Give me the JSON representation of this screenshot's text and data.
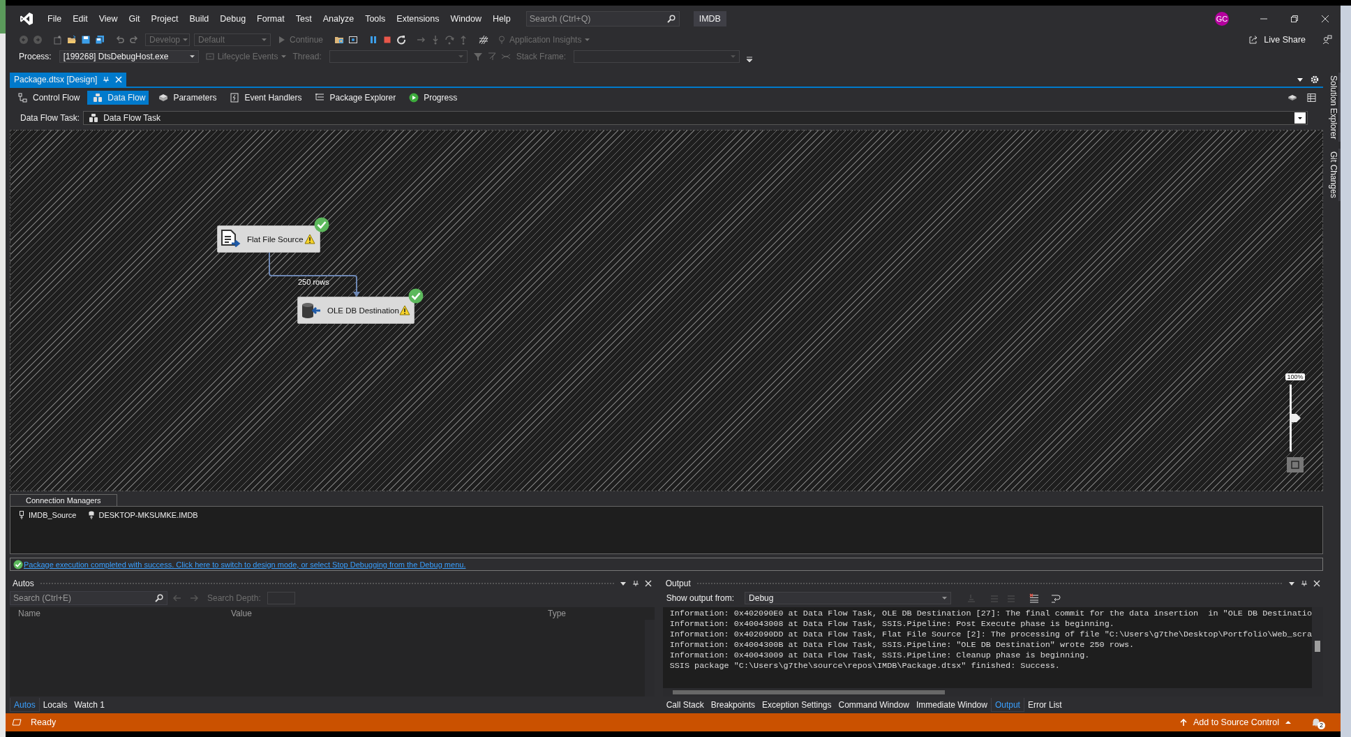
{
  "menu": [
    "File",
    "Edit",
    "View",
    "Git",
    "Project",
    "Build",
    "Debug",
    "Format",
    "Test",
    "Analyze",
    "Tools",
    "Extensions",
    "Window",
    "Help"
  ],
  "search": {
    "placeholder": "Search (Ctrl+Q)"
  },
  "solution_name": "IMDB",
  "user_initials": "GC",
  "toolbar": {
    "configuration": {
      "label": "Develop",
      "disabled": true
    },
    "platform": {
      "label": "Default",
      "disabled": true
    },
    "continue": {
      "label": "Continue",
      "disabled": true
    },
    "application_insights": {
      "label": "Application Insights",
      "disabled": true
    },
    "live_share": "Live Share"
  },
  "debug_bar": {
    "process_label": "Process:",
    "process": "[199268] DtsDebugHost.exe",
    "lifecycle": {
      "label": "Lifecycle Events",
      "disabled": true
    },
    "thread_label": {
      "label": "Thread:",
      "disabled": true
    },
    "stack_frame_label": {
      "label": "Stack Frame:",
      "disabled": true
    }
  },
  "document_tab": {
    "title": "Package.dtsx [Design]",
    "selected": true
  },
  "designer_tabs": [
    {
      "label": "Control Flow",
      "kind": "control",
      "selected": false
    },
    {
      "label": "Data Flow",
      "kind": "dataflow",
      "selected": true
    },
    {
      "label": "Parameters",
      "kind": "parameters",
      "selected": false
    },
    {
      "label": "Event Handlers",
      "kind": "events",
      "selected": false
    },
    {
      "label": "Package Explorer",
      "kind": "explorer",
      "selected": false
    },
    {
      "label": "Progress",
      "kind": "progress",
      "selected": false
    }
  ],
  "task_selector": {
    "label": "Data Flow Task:",
    "value": "Data Flow Task"
  },
  "canvas": {
    "nodes": [
      {
        "label": "Flat File Source",
        "kind": "source",
        "succeeded": true,
        "warning": true
      },
      {
        "label": "OLE DB Destination",
        "kind": "destination",
        "succeeded": true,
        "warning": true
      }
    ],
    "path_label": "250 rows",
    "zoom": {
      "label": "100%",
      "level": 0.5
    }
  },
  "connection_managers": {
    "title": "Connection Managers",
    "items": [
      {
        "label": "IMDB_Source",
        "kind": "flat_file"
      },
      {
        "label": "DESKTOP-MKSUMKE.IMDB",
        "kind": "oledb"
      }
    ]
  },
  "status_message": "Package execution completed with success. Click here to switch to design mode, or select Stop Debugging from the Debug menu.",
  "autos": {
    "title": "Autos",
    "search_placeholder": "Search (Ctrl+E)",
    "search_depth_label": "Search Depth:",
    "columns": [
      "Name",
      "Value",
      "Type"
    ],
    "tabs": [
      {
        "label": "Autos",
        "selected": true
      },
      {
        "label": "Locals",
        "selected": false
      },
      {
        "label": "Watch 1",
        "selected": false
      }
    ]
  },
  "output": {
    "title": "Output",
    "show_from_label": "Show output from:",
    "source": "Debug",
    "lines": [
      "Information: 0x402090E0 at Data Flow Task, OLE DB Destination [27]: The final commit for the data insertion  in \"OLE DB Destinatio",
      "Information: 0x40043008 at Data Flow Task, SSIS.Pipeline: Post Execute phase is beginning.",
      "Information: 0x402090DD at Data Flow Task, Flat File Source [2]: The processing of file \"C:\\Users\\g7the\\Desktop\\Portfolio\\Web_scra",
      "Information: 0x4004300B at Data Flow Task, SSIS.Pipeline: \"OLE DB Destination\" wrote 250 rows.",
      "Information: 0x40043009 at Data Flow Task, SSIS.Pipeline: Cleanup phase is beginning.",
      "SSIS package \"C:\\Users\\g7the\\source\\repos\\IMDB\\Package.dtsx\" finished: Success."
    ],
    "tabs": [
      {
        "label": "Call Stack",
        "selected": false
      },
      {
        "label": "Breakpoints",
        "selected": false
      },
      {
        "label": "Exception Settings",
        "selected": false
      },
      {
        "label": "Command Window",
        "selected": false
      },
      {
        "label": "Immediate Window",
        "selected": false
      },
      {
        "label": "Output",
        "selected": true
      },
      {
        "label": "Error List",
        "selected": false
      }
    ]
  },
  "side_tabs": [
    "Solution Explorer",
    "Git Changes"
  ],
  "status_bar": {
    "text": "Ready",
    "source_control": "Add to Source Control",
    "notifications": "2"
  }
}
